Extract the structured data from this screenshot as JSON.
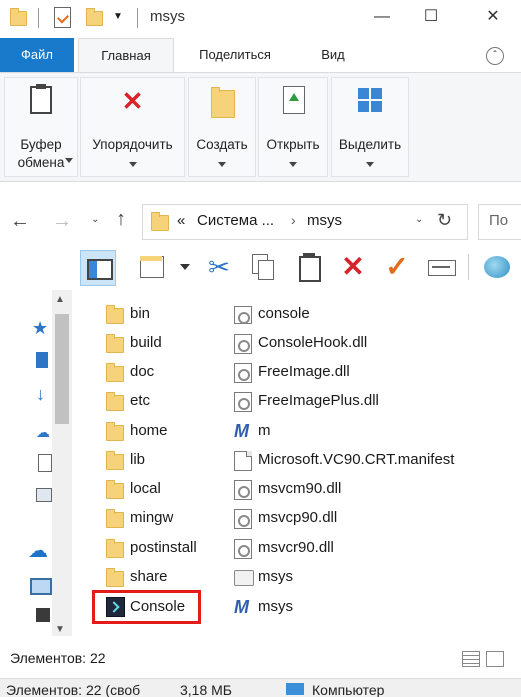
{
  "window": {
    "title": "msys",
    "controls": {
      "minimize": "—",
      "maximize": "☐",
      "close": "✕"
    }
  },
  "ribbon_tabs": [
    "Файл",
    "Главная",
    "Поделиться",
    "Вид"
  ],
  "ribbon_groups": [
    {
      "label": "Буфер обмена",
      "icon": "clipboard-icon"
    },
    {
      "label": "Упорядочить",
      "icon": "delete-x-icon"
    },
    {
      "label": "Создать",
      "icon": "new-folder-icon"
    },
    {
      "label": "Открыть",
      "icon": "open-properties-icon"
    },
    {
      "label": "Выделить",
      "icon": "select-grid-icon"
    }
  ],
  "address_bar": {
    "overflow": "«",
    "crumbs": [
      "Система ...",
      "msys"
    ],
    "search_placeholder": "По"
  },
  "folders": [
    {
      "name": "bin"
    },
    {
      "name": "build"
    },
    {
      "name": "doc"
    },
    {
      "name": "etc"
    },
    {
      "name": "home"
    },
    {
      "name": "lib"
    },
    {
      "name": "local"
    },
    {
      "name": "mingw"
    },
    {
      "name": "postinstall"
    },
    {
      "name": "share"
    }
  ],
  "console_shortcut": {
    "name": "Console",
    "icon": "console-app-icon",
    "highlight_color": "#e31b1b"
  },
  "files": [
    {
      "name": "console",
      "icon": "settings-file-icon"
    },
    {
      "name": "ConsoleHook.dll",
      "icon": "dll-file-icon"
    },
    {
      "name": "FreeImage.dll",
      "icon": "dll-file-icon"
    },
    {
      "name": "FreeImagePlus.dll",
      "icon": "dll-file-icon"
    },
    {
      "name": "m",
      "icon": "msys-m-icon"
    },
    {
      "name": "Microsoft.VC90.CRT.manifest",
      "icon": "blank-file-icon"
    },
    {
      "name": "msvcm90.dll",
      "icon": "dll-file-icon"
    },
    {
      "name": "msvcp90.dll",
      "icon": "dll-file-icon"
    },
    {
      "name": "msvcr90.dll",
      "icon": "dll-file-icon"
    },
    {
      "name": "msys",
      "icon": "config-file-icon"
    },
    {
      "name": "msys",
      "icon": "msys-m-icon"
    }
  ],
  "status": {
    "items_count": "Элементов: 22",
    "bottom_left": "Элементов: 22 (своб",
    "bottom_size": "3,18 МБ",
    "bottom_location": "Компьютер"
  },
  "colors": {
    "file_tab": "#1979ca",
    "folder": "#f6d27a",
    "delete_red": "#d8232a",
    "check_orange": "#e36c1b"
  }
}
